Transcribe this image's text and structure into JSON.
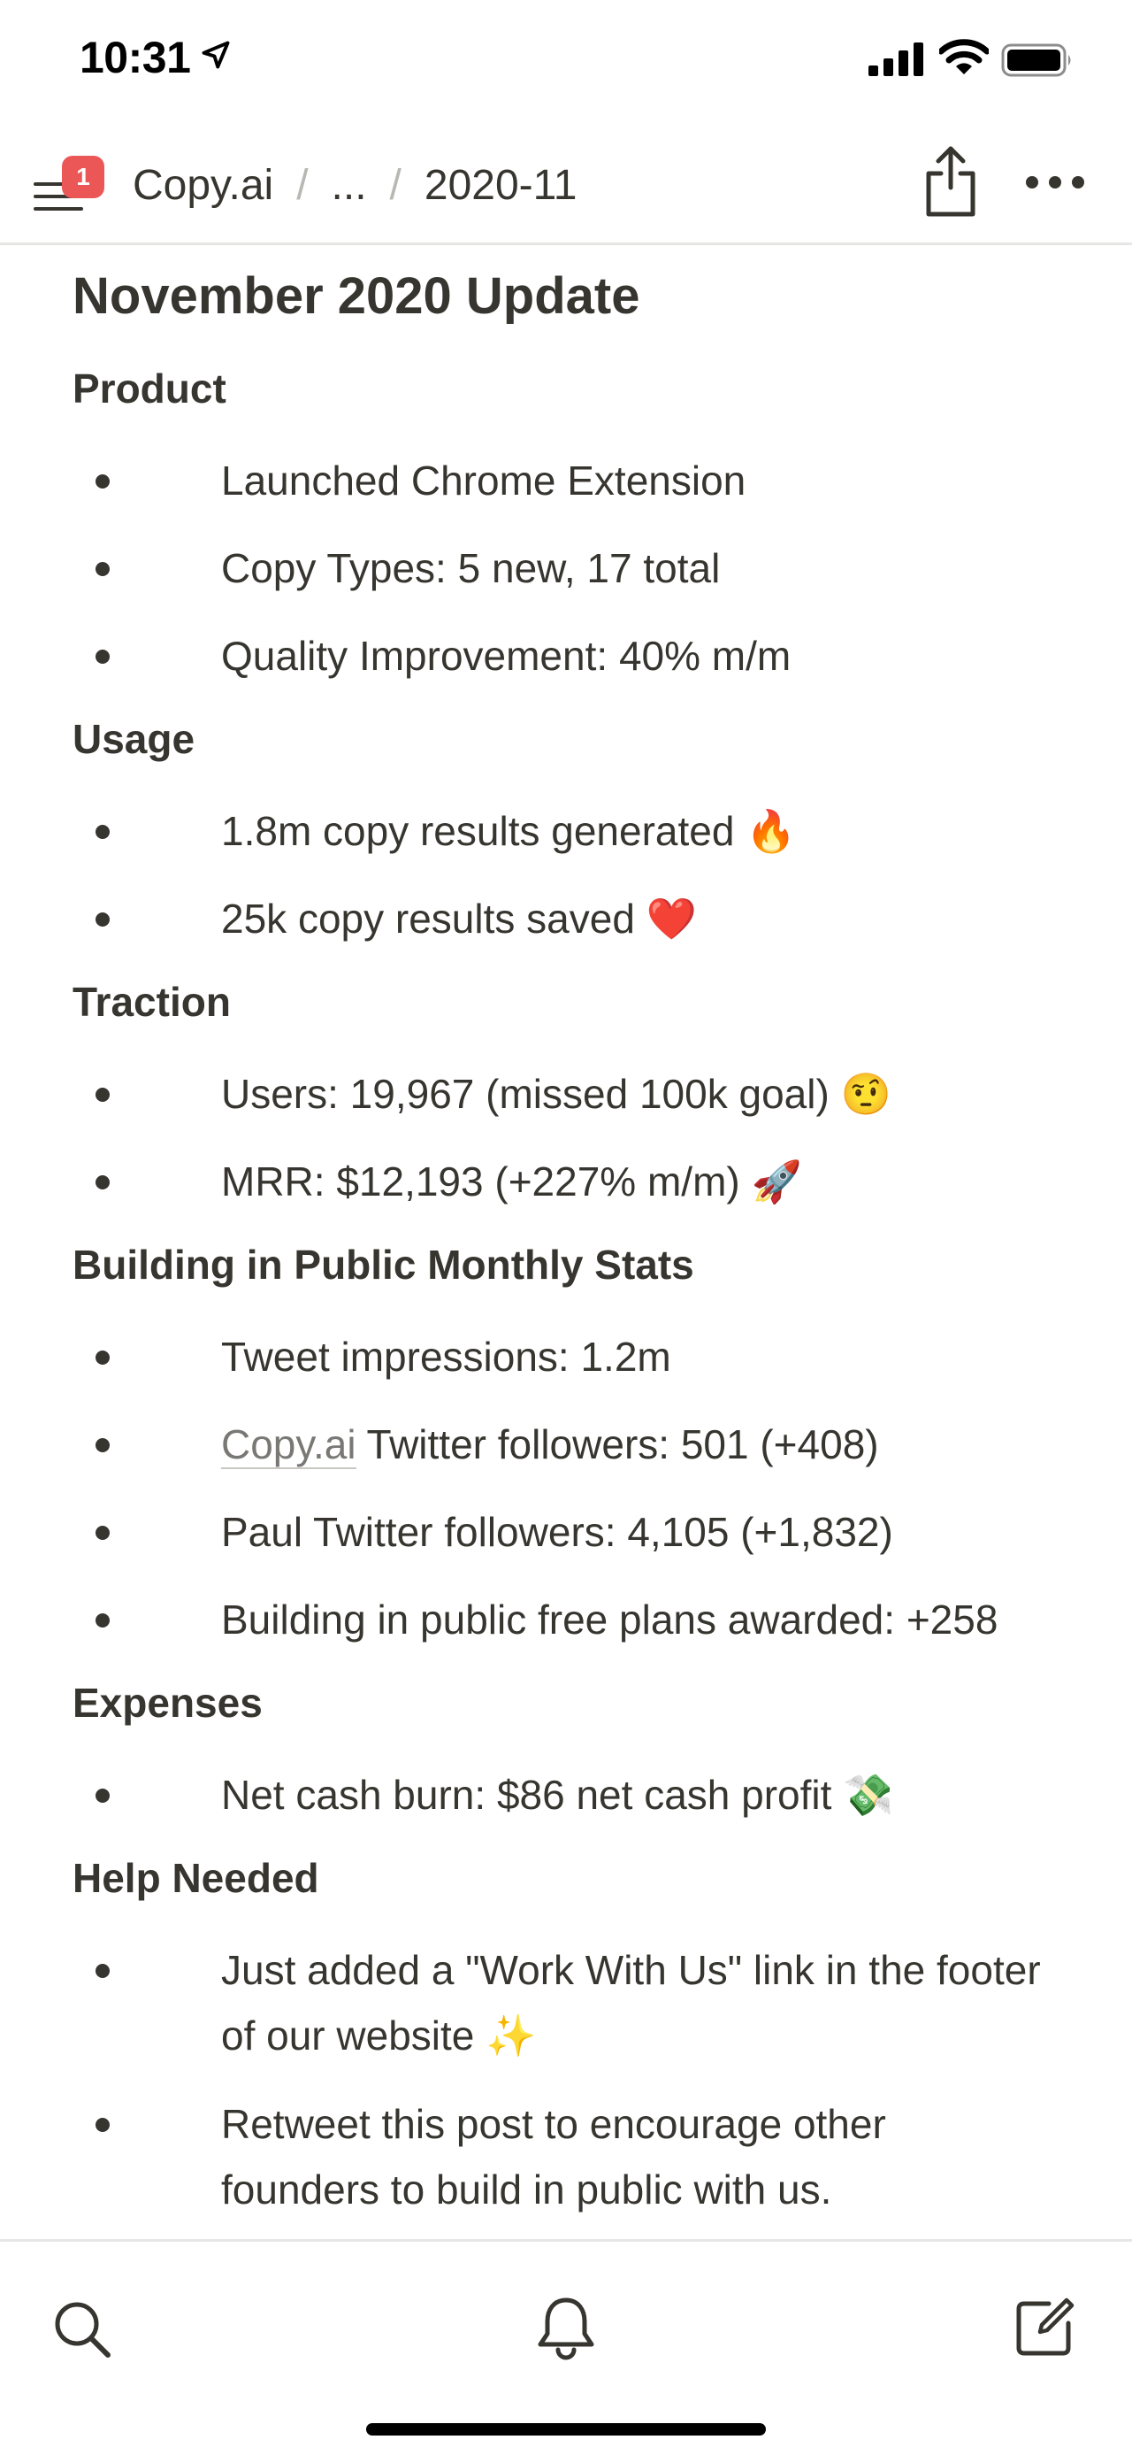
{
  "status_bar": {
    "time": "10:31"
  },
  "nav": {
    "badge_count": "1",
    "breadcrumb": [
      "Copy.ai",
      "...",
      "2020-11"
    ],
    "separator": "/"
  },
  "page": {
    "title": "November 2020 Update",
    "sections": [
      {
        "heading": "Product",
        "items": [
          {
            "text": "Launched Chrome Extension"
          },
          {
            "text": "Copy Types: 5 new, 17 total"
          },
          {
            "text": "Quality Improvement: 40% m/m"
          }
        ]
      },
      {
        "heading": "Usage",
        "items": [
          {
            "text": "1.8m copy results generated",
            "emoji": "🔥"
          },
          {
            "text": "25k copy results saved",
            "emoji": "❤️"
          }
        ]
      },
      {
        "heading": "Traction",
        "items": [
          {
            "text": "Users: 19,967 (missed 100k goal)",
            "emoji": "🤨"
          },
          {
            "text": "MRR: $12,193 (+227% m/m)",
            "emoji": "🚀"
          }
        ]
      },
      {
        "heading": "Building in Public Monthly Stats",
        "items": [
          {
            "text": "Tweet impressions: 1.2m"
          },
          {
            "link": "Copy.ai",
            "text": "Twitter followers: 501 (+408)"
          },
          {
            "text": "Paul Twitter followers: 4,105 (+1,832)"
          },
          {
            "text": "Building in public free plans awarded: +258"
          }
        ]
      },
      {
        "heading": "Expenses",
        "items": [
          {
            "text": "Net cash burn: $86 net cash profit",
            "emoji": "💸"
          }
        ]
      },
      {
        "heading": "Help Needed",
        "items": [
          {
            "line1": "Just added a \"Work With Us\" link in the footer",
            "line2": "of our website",
            "emoji": "✨"
          },
          {
            "line1": "Retweet this post to encourage other",
            "line2": "founders to build in public with us."
          }
        ]
      }
    ]
  },
  "colors": {
    "text": "#37352f",
    "badge": "#eb5757",
    "divider": "#e6e6e4"
  },
  "icons": [
    "location-arrow-icon",
    "cellular-signal-icon",
    "wifi-icon",
    "battery-icon",
    "hamburger-menu-icon",
    "share-icon",
    "more-icon",
    "search-icon",
    "bell-icon",
    "compose-icon"
  ]
}
